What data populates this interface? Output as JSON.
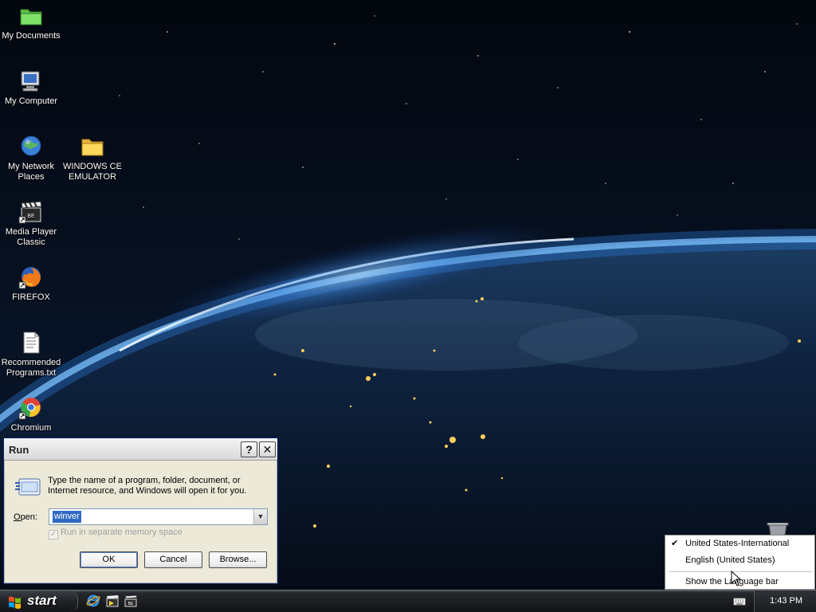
{
  "desktop": {
    "icons": [
      {
        "label": "My Documents"
      },
      {
        "label": "My Computer"
      },
      {
        "label": "My Network Places"
      },
      {
        "label": "WINDOWS CE EMULATOR"
      },
      {
        "label": "Media Player Classic"
      },
      {
        "label": "FIREFOX"
      },
      {
        "label": "Recommended Programs.txt"
      },
      {
        "label": "Chromium"
      }
    ]
  },
  "run_dialog": {
    "title": "Run",
    "help_glyph": "?",
    "close_glyph": "✕",
    "description": "Type the name of a program, folder, document, or Internet resource, and Windows will open it for you.",
    "open_label_prefix": "O",
    "open_label_rest": "pen:",
    "open_value": "winver",
    "separate_memory_label": "Run in separate memory space",
    "ok_label": "OK",
    "cancel_label": "Cancel",
    "browse_label": "Browse..."
  },
  "language_menu": {
    "items": [
      {
        "label": "United States-International",
        "checked": true
      },
      {
        "label": "English (United States)",
        "checked": false
      }
    ],
    "show_bar_label": "Show the Language bar"
  },
  "taskbar": {
    "start_label": "start",
    "clock": "1:43 PM"
  },
  "icons": {
    "desktop": [
      "folder-green-icon",
      "computer-icon",
      "network-globe-icon",
      "folder-icon",
      "clapperboard-icon",
      "firefox-icon",
      "text-file-icon",
      "chromium-icon"
    ],
    "quick_launch": [
      "internet-explorer-icon",
      "media-player-icon",
      "clapperboard-icon"
    ],
    "tray": [
      "keyboard-icon"
    ],
    "other": [
      "recycle-bin-icon"
    ]
  },
  "colors": {
    "selection": "#316ac5",
    "dialog_bg": "#ece9d8",
    "taskbar": "#1c1e21"
  }
}
